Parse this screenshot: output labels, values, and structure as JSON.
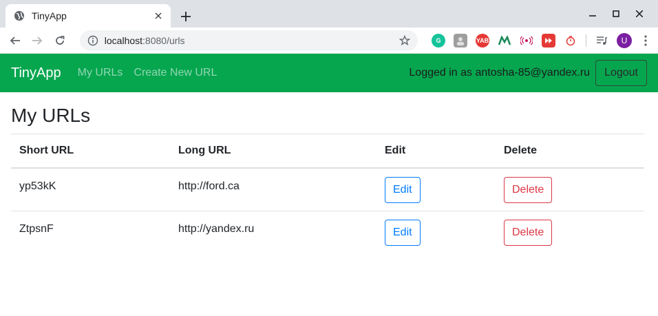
{
  "browser": {
    "tab_title": "TinyApp",
    "url_host": "localhost",
    "url_rest": ":8080/urls",
    "profile_initial": "U",
    "extensions": [
      "grammarly-icon",
      "profile-ext-icon",
      "yab-icon",
      "m-ext-icon",
      "cast-ext-icon",
      "youtube-ext-icon",
      "timer-ext-icon"
    ],
    "ext_labels": {
      "yab": "YAB"
    }
  },
  "navbar": {
    "brand": "TinyApp",
    "links": [
      "My URLs",
      "Create New URL"
    ],
    "logged_in_text": "Logged in as antosha-85@yandex.ru",
    "logout_label": "Logout",
    "color": "#06a64f"
  },
  "page": {
    "heading": "My URLs"
  },
  "table": {
    "headers": [
      "Short URL",
      "Long URL",
      "Edit",
      "Delete"
    ],
    "rows": [
      {
        "short": "yp53kK",
        "long": "http://ford.ca",
        "edit": "Edit",
        "delete": "Delete"
      },
      {
        "short": "ZtpsnF",
        "long": "http://yandex.ru",
        "edit": "Edit",
        "delete": "Delete"
      }
    ]
  }
}
